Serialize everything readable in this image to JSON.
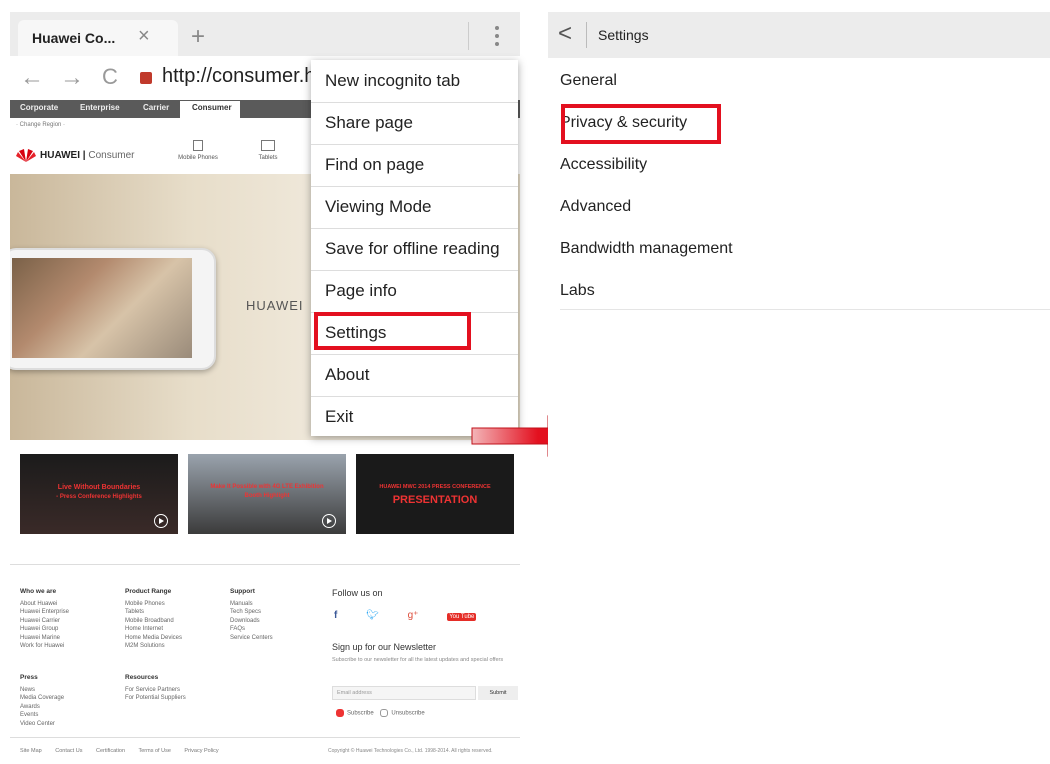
{
  "browser": {
    "tab_title": "Huawei Co...",
    "tab_close": "×",
    "new_tab": "+",
    "url": "http://consumer.hu",
    "nav_back": "←",
    "nav_forward": "→",
    "nav_reload": "C"
  },
  "site": {
    "nav_items": [
      "Corporate",
      "Enterprise",
      "Carrier",
      "Consumer"
    ],
    "region_label": "· Change Region ·",
    "brand": "HUAWEI",
    "brand_sub": "Consumer",
    "device_1": "Mobile Phones",
    "device_2": "Tablets",
    "hero_brand": "HUAWEI",
    "videos": [
      {
        "title": "Live Without Boundaries",
        "subtitle": "- Press Conference Highlights"
      },
      {
        "title": "Make It Possible with 4G LTE Exhibition",
        "subtitle": "Booth Highlight"
      },
      {
        "title": "HUAWEI MWC 2014 PRESS CONFERENCE",
        "subtitle": "PRESENTATION"
      }
    ],
    "footer": {
      "col1_head": "Who we are",
      "col1": [
        "About Huawei",
        "Huawei Enterprise",
        "Huawei Carrier",
        "Huawei Group",
        "Huawei Marine",
        "Work for Huawei"
      ],
      "col2_head": "Product Range",
      "col2": [
        "Mobile Phones",
        "Tablets",
        "Mobile Broadband",
        "Home Internet",
        "Home Media Devices",
        "M2M Solutions"
      ],
      "col3_head": "Support",
      "col3": [
        "Manuals",
        "Tech Specs",
        "Downloads",
        "FAQs",
        "Service Centers"
      ],
      "col4_head": "Press",
      "col4": [
        "News",
        "Media Coverage",
        "Awards",
        "Events",
        "Video Center"
      ],
      "col5_head": "Resources",
      "col5": [
        "For Service Partners",
        "For Potential Suppliers"
      ],
      "follow": "Follow us on",
      "newsletter": "Sign up for our Newsletter",
      "newsletter_sub": "Subscribe to our newsletter for all the latest updates and special offers",
      "email_placeholder": "Email address",
      "submit": "Submit",
      "subscribe": "Subscribe",
      "unsubscribe": "Unsubscribe",
      "bottom_links": [
        "Site Map",
        "Contact Us",
        "Certification",
        "Terms of Use",
        "Privacy Policy"
      ],
      "copyright": "Copyright © Huawei Technologies Co., Ltd. 1998-2014. All rights reserved."
    }
  },
  "menu": {
    "items": [
      "New incognito tab",
      "Share page",
      "Find on page",
      "Viewing Mode",
      "Save for offline reading",
      "Page info",
      "Settings",
      "About",
      "Exit"
    ]
  },
  "settings": {
    "title": "Settings",
    "back": "<",
    "items": [
      "General",
      "Privacy & security",
      "Accessibility",
      "Advanced",
      "Bandwidth management",
      "Labs"
    ]
  },
  "colors": {
    "highlight": "#e3101f",
    "arrow": "#e3101f"
  }
}
